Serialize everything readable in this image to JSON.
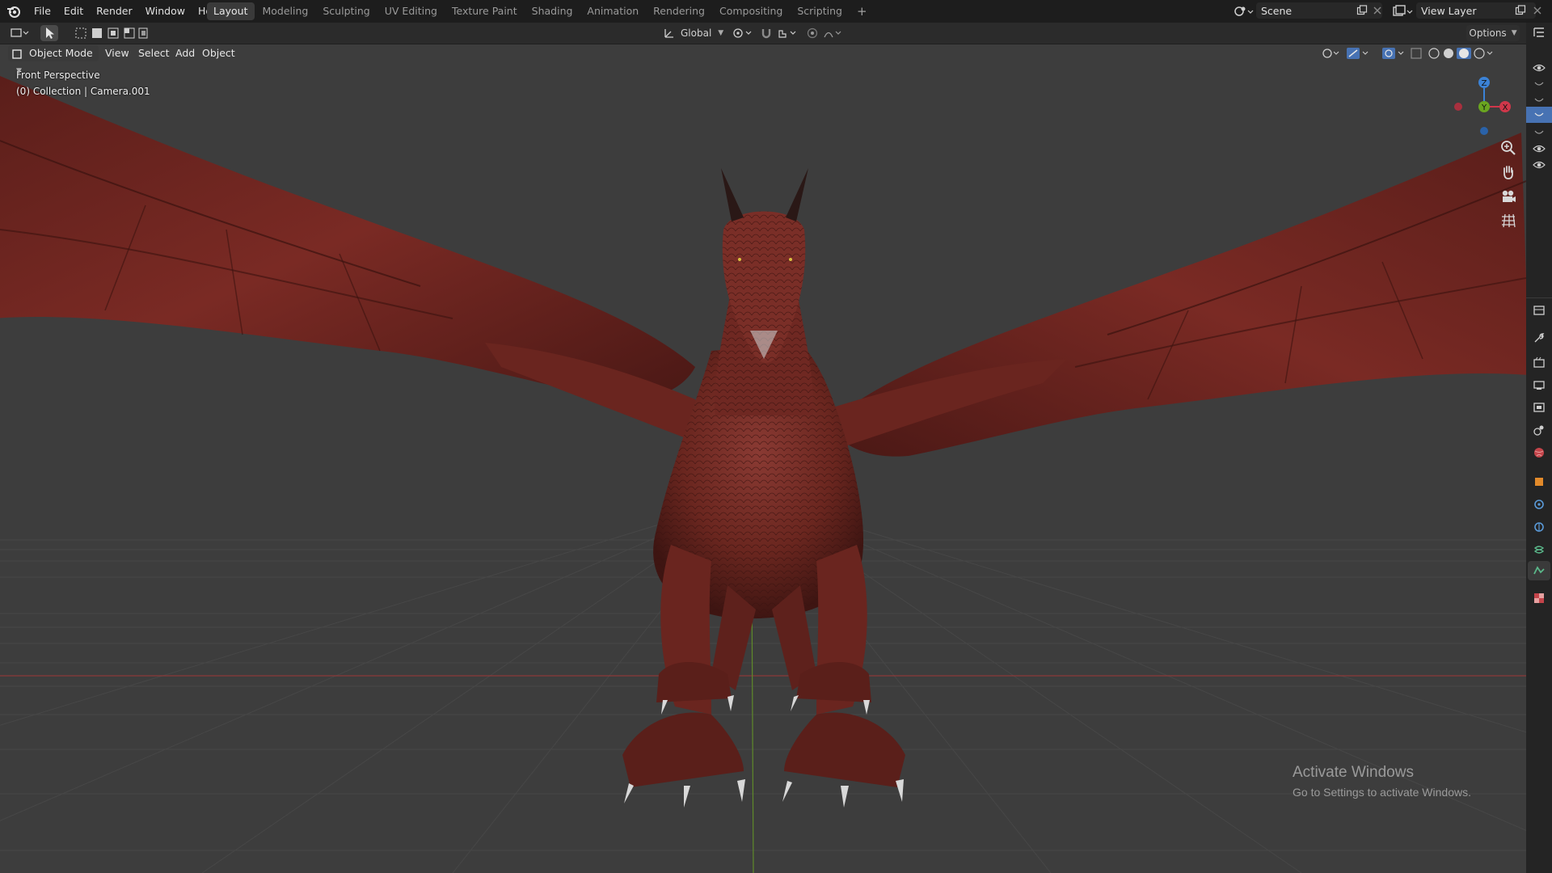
{
  "menu": {
    "file": "File",
    "edit": "Edit",
    "render": "Render",
    "window": "Window",
    "help": "Help"
  },
  "workspaces": {
    "layout": "Layout",
    "modeling": "Modeling",
    "sculpting": "Sculpting",
    "uv_editing": "UV Editing",
    "texture_paint": "Texture Paint",
    "shading": "Shading",
    "animation": "Animation",
    "rendering": "Rendering",
    "compositing": "Compositing",
    "scripting": "Scripting",
    "add": "+"
  },
  "scene": {
    "name": "Scene"
  },
  "view_layer": {
    "name": "View Layer"
  },
  "header": {
    "orientation": "Global",
    "options": "Options"
  },
  "viewport_header": {
    "mode": "Object Mode",
    "view": "View",
    "select": "Select",
    "add": "Add",
    "object": "Object"
  },
  "viewport": {
    "view_name": "Front Perspective",
    "collection_info": "(0) Collection | Camera.001",
    "gizmo": {
      "z": "Z",
      "y": "Y",
      "x": "X"
    }
  },
  "watermark": {
    "title": "Activate Windows",
    "subtitle": "Go to Settings to activate Windows."
  },
  "colors": {
    "accent": "#4772b3",
    "dragon": "#6e2620",
    "x_axis": "#d0374a",
    "y_axis": "#6aa520",
    "z_axis": "#3b82d6"
  },
  "icons": [
    "blender-logo-icon",
    "select-box-icon",
    "eye-icon",
    "zoom-icon",
    "hand-icon",
    "camera-icon",
    "grid-icon",
    "tool-icon",
    "render-icon",
    "output-icon",
    "view-layer-icon",
    "scene-icon",
    "world-icon",
    "object-icon",
    "modifier-icon",
    "physics-icon",
    "constraint-icon",
    "data-icon",
    "texture-icon"
  ]
}
